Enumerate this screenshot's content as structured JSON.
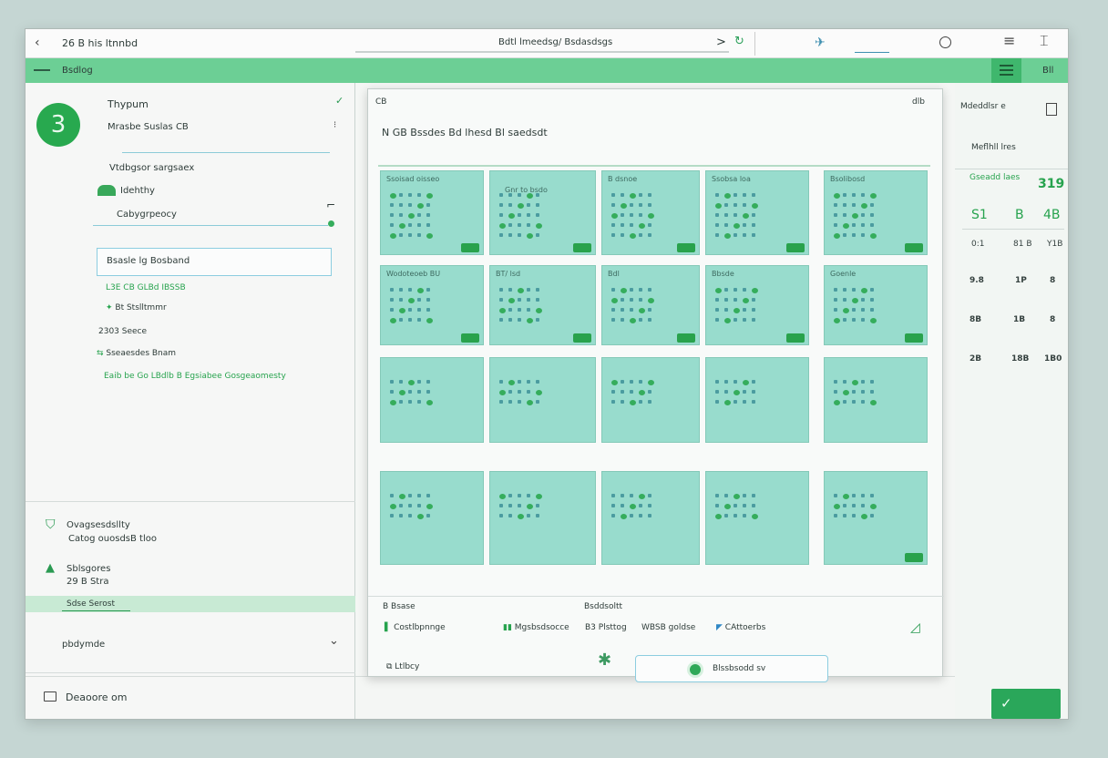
{
  "titlebar": {
    "back_icon": "chevron-left-icon",
    "title": "26 B his ltnnbd",
    "address": "Bdtl lmeedsg/ Bsdasdsgs",
    "chevron_right": ">",
    "right_lines": [
      "≡",
      "⌶"
    ]
  },
  "greenbar": {
    "label": "Bsdlog",
    "right_label": "Bll"
  },
  "sidebar": {
    "avatar_text": "3",
    "name": "Thypum",
    "subtitle": "Mrasbe Suslas CB",
    "items": [
      "Vtdbgsor sargsaex",
      "Idehthy",
      "Cabygrpeocy"
    ],
    "search_value": "Bsasle lg Bosband",
    "section_lines": [
      "L3E CB GLBd IBSSB",
      "Bt Stslltmmr",
      "2303 Seece",
      "Sseaesdes Bnam",
      "Eaib be Go LBdlb B Egsiabee Gosgeaomesty"
    ],
    "bottom_entries": [
      {
        "title": "Ovagsesdsllty",
        "sub": "Catog ouosdsB tloo"
      },
      {
        "title": "Sblsgores",
        "sub": "29 B Stra"
      }
    ],
    "selected_label": "Sdse Serost",
    "dropdown_label": "pbdymde",
    "footer_label": "Deaoore om"
  },
  "panel": {
    "top_left": "CB",
    "top_right": "dlb",
    "heading": "N GB Bssdes Bd lhesd Bl saedsdt",
    "tile_labels": [
      "Ssoisad oisseo",
      "Gnr to bsdo",
      "B dsnoe",
      "Ssobsa loa",
      "Bsolibosd",
      "Wodoteoeb BU",
      "BT/ lsd",
      "Bdl",
      "Bbsde",
      "Goenle",
      "",
      "",
      "",
      "",
      "",
      "",
      "",
      "",
      "",
      ""
    ],
    "bottom_caption_left": "B Bsase",
    "bottom_caption_mid": "Bsddsoltt",
    "bottom_items": [
      "Costlbpnnge",
      "Mgsbsdsocce",
      "B3 Plsttog",
      "WBSB goldse",
      "CAttoerbs"
    ],
    "bottom_left2": "Ltlbcy",
    "chat_placeholder": "Blssbsodd sv"
  },
  "right_panel": {
    "label1": "Mdeddlsr e",
    "label2": "Meflhll lres",
    "label3": "Gseadd laes",
    "big_num": "319",
    "row_main": [
      "S1",
      "B",
      "4B"
    ],
    "grid": [
      [
        "0:1",
        "81 B",
        "Y1B"
      ],
      [
        "9.8",
        "1P",
        "8"
      ],
      [
        "8B",
        "1B",
        "8"
      ],
      [
        "2B",
        "18B",
        "1B0"
      ]
    ]
  },
  "colors": {
    "accent": "#6ccf95",
    "tile": "#98dccd",
    "green_dot": "#35ad5c"
  }
}
